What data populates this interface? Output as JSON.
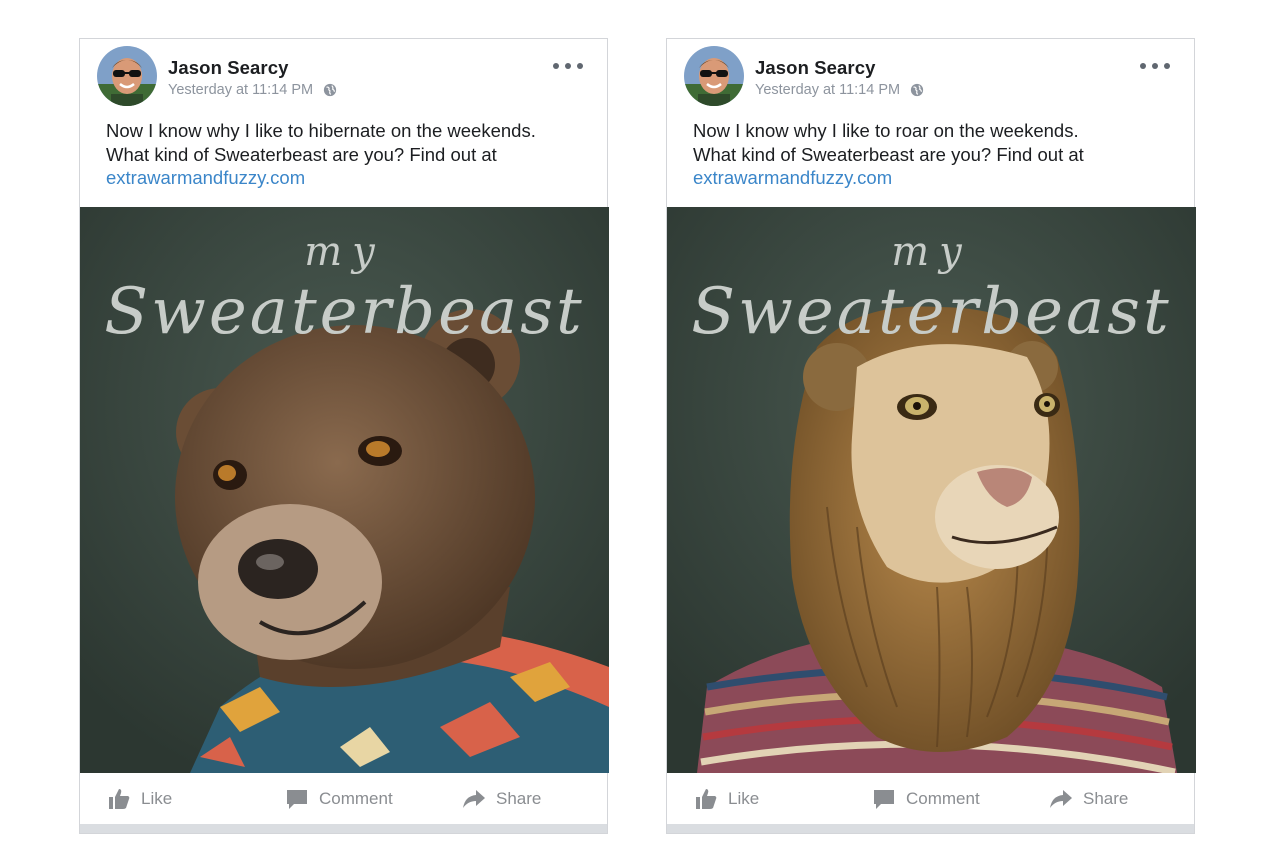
{
  "posts": [
    {
      "author": "Jason Searcy",
      "timestamp": "Yesterday at 11:14 PM",
      "privacy_icon": "globe-icon",
      "text_lines": [
        "Now I know why I like to hibernate on the weekends.",
        "What kind of Sweaterbeast are you? Find out at"
      ],
      "link": "extrawarmandfuzzy.com",
      "image": {
        "caption_small": "my",
        "caption_big": "Sweaterbeast",
        "subject": "bear"
      },
      "actions": {
        "like": "Like",
        "comment": "Comment",
        "share": "Share"
      }
    },
    {
      "author": "Jason Searcy",
      "timestamp": "Yesterday at 11:14 PM",
      "privacy_icon": "globe-icon",
      "text_lines": [
        "Now I know why I like to roar on the weekends.",
        "What kind of Sweaterbeast are you? Find out at"
      ],
      "link": "extrawarmandfuzzy.com",
      "image": {
        "caption_small": "my",
        "caption_big": "Sweaterbeast",
        "subject": "lion"
      },
      "actions": {
        "like": "Like",
        "comment": "Comment",
        "share": "Share"
      }
    }
  ],
  "colors": {
    "link": "#3b86c9",
    "meta": "#8d949e",
    "photo_background": "#3a4740",
    "action_text": "#8a8d91"
  }
}
